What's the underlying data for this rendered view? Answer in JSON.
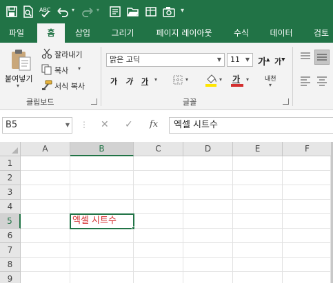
{
  "theme": {
    "accent": "#217346",
    "ribbon_bg": "#f3f3f3",
    "cell_text_color": "#d32f2f"
  },
  "qat": {
    "items": [
      "save-icon",
      "print-preview-icon",
      "spelling-check-icon",
      "undo-icon",
      "redo-icon",
      "form-icon",
      "open-icon",
      "new-sheet-icon",
      "camera-icon",
      "customize-icon"
    ]
  },
  "tabs": [
    {
      "label": "파일",
      "active": false
    },
    {
      "label": "홈",
      "active": true
    },
    {
      "label": "삽입",
      "active": false
    },
    {
      "label": "그리기",
      "active": false
    },
    {
      "label": "페이지 레이아웃",
      "active": false
    },
    {
      "label": "수식",
      "active": false
    },
    {
      "label": "데이터",
      "active": false
    },
    {
      "label": "검토",
      "active": false
    }
  ],
  "clipboard": {
    "paste_label": "붙여넣기",
    "cut_label": "잘라내기",
    "copy_label": "복사",
    "format_painter_label": "서식 복사",
    "group_label": "클립보드"
  },
  "font": {
    "font_name": "맑은 고딕",
    "font_size": "11",
    "bold_label": "가",
    "italic_label": "가",
    "underline_label": "가",
    "font_color_label": "가",
    "phonetic_label": "내천",
    "grow_label": "가",
    "shrink_label": "가",
    "group_label": "글꼴"
  },
  "formula_bar": {
    "name_box": "B5",
    "fx_label": "fx",
    "content": "엑셀 시트수"
  },
  "grid": {
    "columns": [
      "A",
      "B",
      "C",
      "D",
      "E",
      "F"
    ],
    "rows": [
      "1",
      "2",
      "3",
      "4",
      "5",
      "6",
      "7",
      "8",
      "9"
    ],
    "selected_column": "B",
    "selected_row": "5",
    "active_cell_value": "엑셀 시트수"
  }
}
